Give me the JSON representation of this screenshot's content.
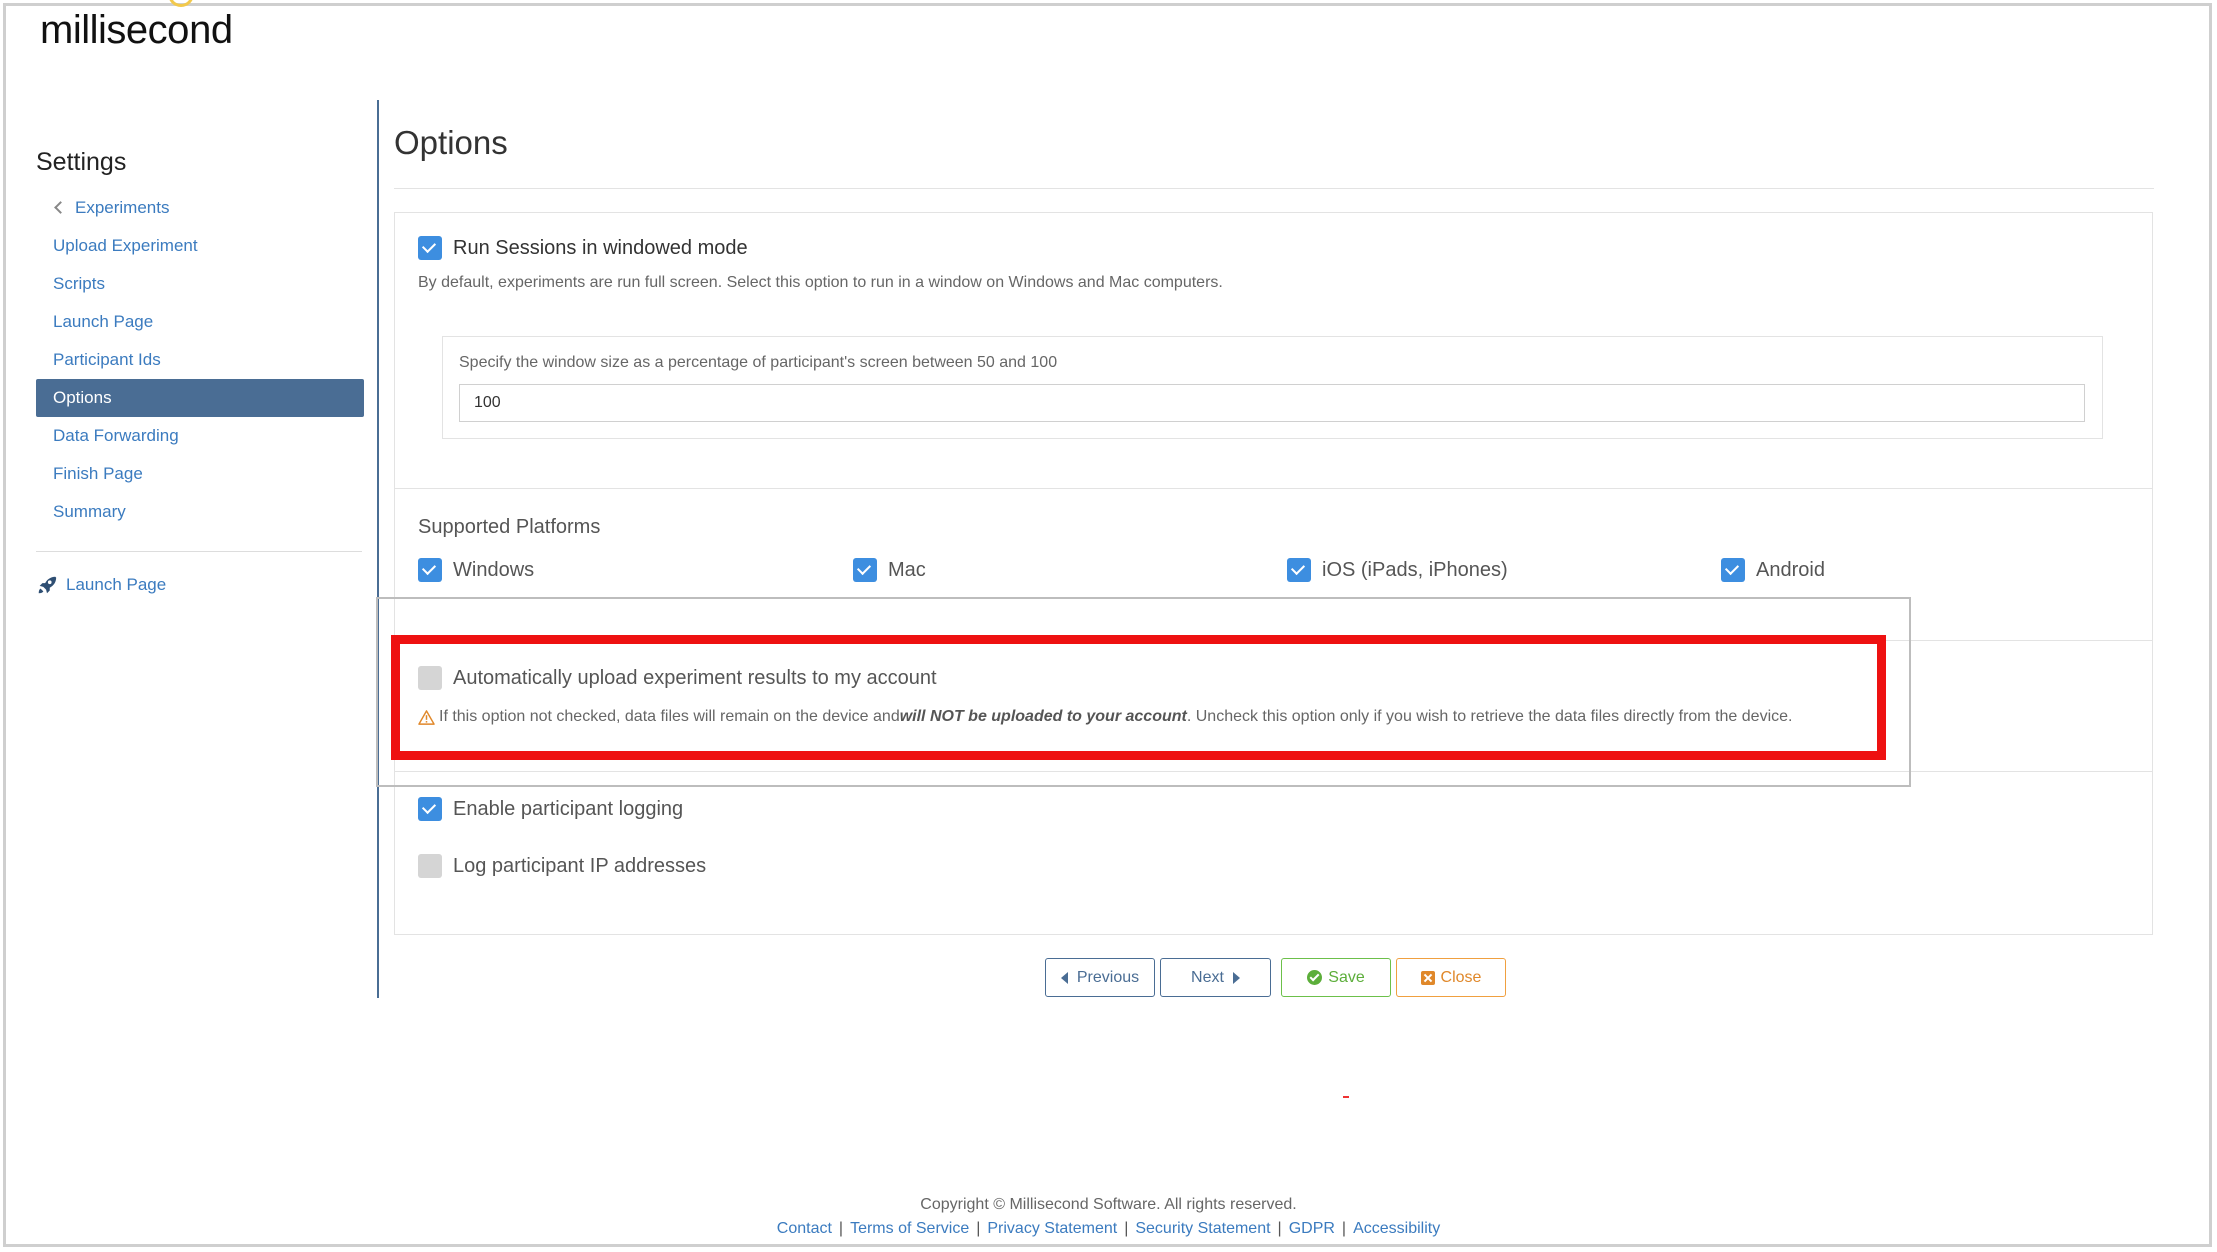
{
  "brand": {
    "logo_text_a": "millisec",
    "logo_text_b": "nd"
  },
  "sidebar": {
    "title": "Settings",
    "items": [
      {
        "label": "Experiments",
        "back": true
      },
      {
        "label": "Upload Experiment"
      },
      {
        "label": "Scripts"
      },
      {
        "label": "Launch Page"
      },
      {
        "label": "Participant Ids"
      },
      {
        "label": "Options",
        "active": true
      },
      {
        "label": "Data Forwarding"
      },
      {
        "label": "Finish Page"
      },
      {
        "label": "Summary"
      }
    ],
    "launch_link": "Launch Page"
  },
  "main": {
    "title": "Options",
    "windowed": {
      "label": "Run Sessions in windowed mode",
      "checked": true,
      "help": "By default, experiments are run full screen. Select this option to run in a window on Windows and Mac computers.",
      "size_label": "Specify the window size as a percentage of participant's screen between 50 and 100",
      "size_value": "100"
    },
    "platforms": {
      "title": "Supported Platforms",
      "items": [
        {
          "label": "Windows",
          "checked": true
        },
        {
          "label": "Mac",
          "checked": true
        },
        {
          "label": "iOS (iPads, iPhones)",
          "checked": true
        },
        {
          "label": "Android",
          "checked": true
        }
      ]
    },
    "auto_upload": {
      "label": "Automatically upload experiment results to my account",
      "checked": false,
      "warn_pre": "If this option not checked, data files will remain on the device and ",
      "warn_bold": "will NOT be uploaded to your account",
      "warn_post": ". Uncheck this option only if you wish to retrieve the data files directly from the device."
    },
    "logging": {
      "label": "Enable participant logging",
      "checked": true
    },
    "ip_log": {
      "label": "Log participant IP addresses",
      "checked": false
    }
  },
  "buttons": {
    "previous": "Previous",
    "next": "Next",
    "save": "Save",
    "close": "Close"
  },
  "footer": {
    "copyright": "Copyright © Millisecond Software. All rights reserved.",
    "links": [
      "Contact",
      "Terms of Service",
      "Privacy Statement",
      "Security Statement",
      "GDPR",
      "Accessibility"
    ],
    "separator": "|"
  },
  "colors": {
    "accent": "#4a6d94",
    "link": "#3b7bbf",
    "checkbox": "#3d8ee0",
    "highlight": "#ee1111",
    "save": "#5cae3a",
    "close": "#e0882a"
  }
}
